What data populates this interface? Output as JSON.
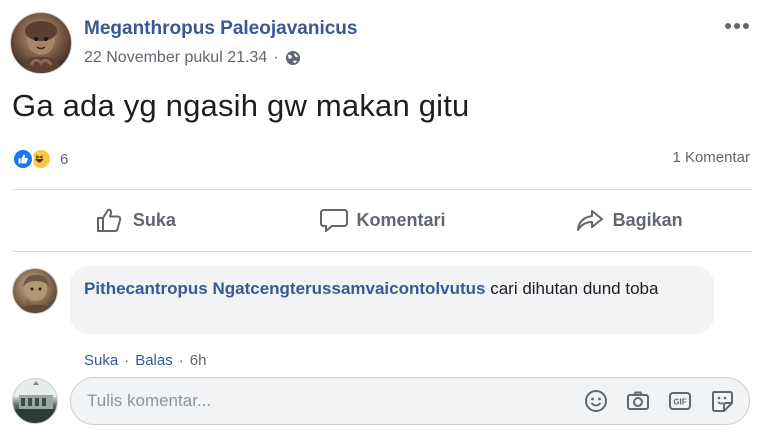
{
  "post": {
    "author": "Meganthropus Paleojavanicus",
    "date": "22 November pukul 21.34",
    "separator": "·",
    "text": "Ga ada yg ngasih gw makan gitu",
    "reaction_count": "6",
    "comment_count": "1 Komentar"
  },
  "actions": {
    "like": "Suka",
    "comment": "Komentari",
    "share": "Bagikan"
  },
  "comments": [
    {
      "author": "Pithecantropus Ngatcengterussamvaicontolvutus",
      "text": " cari dihutan dund toba",
      "like_label": "Suka",
      "reply_label": "Balas",
      "time": "6h",
      "separator": "·"
    }
  ],
  "composer": {
    "placeholder": "Tulis komentar..."
  },
  "colors": {
    "link": "#385898",
    "muted": "#606770",
    "like_blue": "#1877f2",
    "haha_yellow": "#f7c843"
  },
  "icons": [
    "more-icon",
    "globe-icon",
    "like-reaction-icon",
    "haha-reaction-icon",
    "thumbs-up-icon",
    "comment-icon",
    "share-icon",
    "emoji-icon",
    "camera-icon",
    "gif-icon",
    "sticker-icon"
  ]
}
